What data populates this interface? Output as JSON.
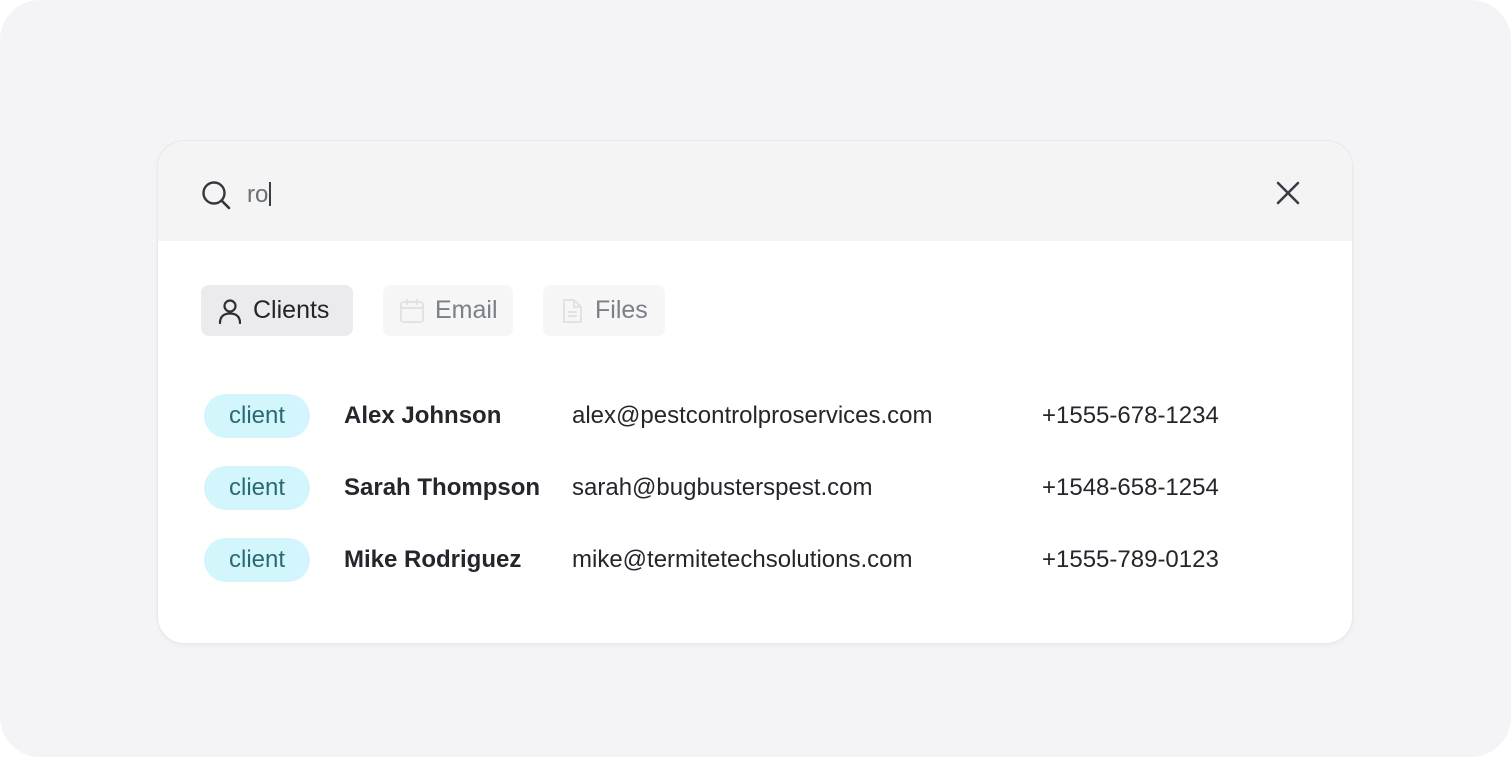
{
  "search": {
    "query": "ro",
    "icon": "search-icon",
    "close_icon": "close-icon"
  },
  "tabs": [
    {
      "label": "Clients",
      "icon": "user-icon",
      "active": true
    },
    {
      "label": "Email",
      "icon": "calendar-icon",
      "active": false
    },
    {
      "label": "Files",
      "icon": "file-icon",
      "active": false
    }
  ],
  "results": [
    {
      "badge": "client",
      "name": "Alex Johnson",
      "email": "alex@pestcontrolproservices.com",
      "phone": "+1555-678-1234"
    },
    {
      "badge": "client",
      "name": "Sarah Thompson",
      "email": "sarah@bugbusterspest.com",
      "phone": "+1548-658-1254"
    },
    {
      "badge": "client",
      "name": "Mike Rodriguez",
      "email": "mike@termitetechsolutions.com",
      "phone": "+1555-789-0123"
    }
  ],
  "colors": {
    "badge_bg": "#d2f6fb",
    "active_tab_bg": "#ebebed",
    "search_bar_bg": "#f4f4f5"
  }
}
